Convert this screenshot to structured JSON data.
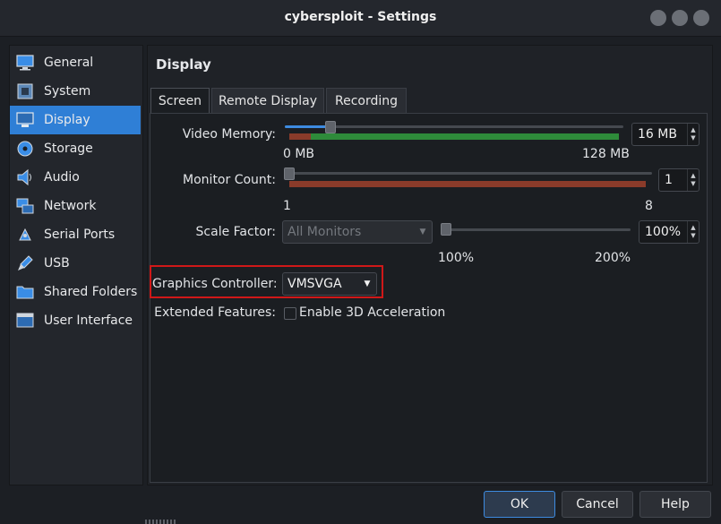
{
  "window": {
    "title": "cybersploit - Settings"
  },
  "sidebar": {
    "items": [
      {
        "label": "General",
        "icon": "monitor-icon"
      },
      {
        "label": "System",
        "icon": "chip-icon"
      },
      {
        "label": "Display",
        "icon": "display-icon",
        "selected": true
      },
      {
        "label": "Storage",
        "icon": "disk-icon"
      },
      {
        "label": "Audio",
        "icon": "speaker-icon"
      },
      {
        "label": "Network",
        "icon": "network-icon"
      },
      {
        "label": "Serial Ports",
        "icon": "serial-port-icon"
      },
      {
        "label": "USB",
        "icon": "usb-icon"
      },
      {
        "label": "Shared Folders",
        "icon": "folder-icon"
      },
      {
        "label": "User Interface",
        "icon": "window-icon"
      }
    ]
  },
  "panel": {
    "title": "Display",
    "tabs": [
      {
        "label": "Screen",
        "active": true
      },
      {
        "label": "Remote Display"
      },
      {
        "label": "Recording"
      }
    ],
    "video_memory": {
      "label": "Video Memory:",
      "value": "16 MB",
      "min_label": "0 MB",
      "max_label": "128 MB",
      "slider_fraction": 0.16
    },
    "monitor_count": {
      "label": "Monitor Count:",
      "value": "1",
      "min_label": "1",
      "max_label": "8",
      "slider_fraction": 0.0
    },
    "scale_factor": {
      "label": "Scale Factor:",
      "combo_value": "All Monitors",
      "value": "100%",
      "min_label": "100%",
      "max_label": "200%",
      "slider_fraction": 0.0
    },
    "graphics_controller": {
      "label": "Graphics Controller:",
      "value": "VMSVGA"
    },
    "extended_features": {
      "label": "Extended Features:",
      "checkbox_label": "Enable 3D Acceleration",
      "checked": false
    }
  },
  "buttons": {
    "ok": "OK",
    "cancel": "Cancel",
    "help": "Help"
  },
  "colors": {
    "accent": "#2f7fd6",
    "highlight": "#d01818",
    "range_green": "#2e8b3a",
    "range_red": "#8a3b2a"
  }
}
